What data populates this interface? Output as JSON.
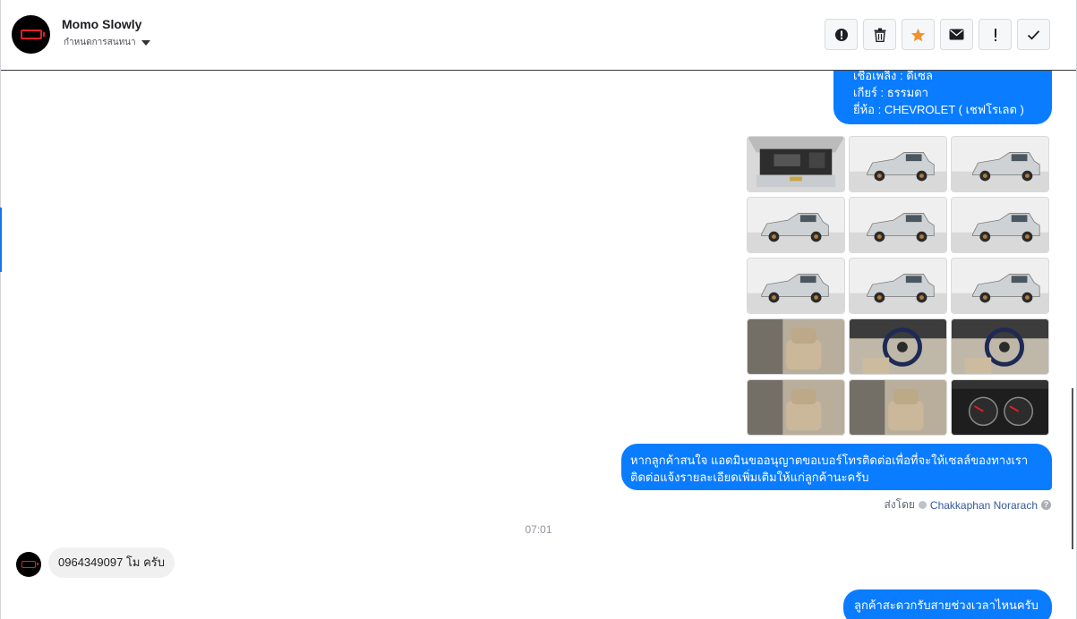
{
  "header": {
    "contact_name": "Momo Slowly",
    "assign_label": "กำหนดการสนทนา",
    "toolbar": [
      {
        "name": "spam-button",
        "icon": "alert-circle-icon"
      },
      {
        "name": "delete-button",
        "icon": "trash-icon"
      },
      {
        "name": "star-button",
        "icon": "star-icon",
        "color": "#f0922b"
      },
      {
        "name": "mark-unread-button",
        "icon": "envelope-icon"
      },
      {
        "name": "follow-up-button",
        "icon": "exclamation-icon"
      },
      {
        "name": "mark-done-button",
        "icon": "check-icon"
      }
    ]
  },
  "conversation": {
    "top_bubble": {
      "lines": [
        "เชื้อเพลิง : ดีเซล",
        "เกียร์ : ธรรมดา",
        "ยี่ห้อ : CHEVROLET ( เชฟโรเลต )"
      ]
    },
    "gallery": {
      "photos": [
        {
          "subject": "engine-bay"
        },
        {
          "subject": "truck-front-left"
        },
        {
          "subject": "truck-front"
        },
        {
          "subject": "truck-side-front"
        },
        {
          "subject": "truck-rear-right"
        },
        {
          "subject": "truck-rear"
        },
        {
          "subject": "truck-rear-left"
        },
        {
          "subject": "truck-side-wide"
        },
        {
          "subject": "truck-wheel-closeup"
        },
        {
          "subject": "door-panel"
        },
        {
          "subject": "steering-wheel"
        },
        {
          "subject": "dashboard-steering"
        },
        {
          "subject": "front-seats"
        },
        {
          "subject": "rear-cab"
        },
        {
          "subject": "instrument-cluster"
        }
      ]
    },
    "agent_message": {
      "line1": "หากลูกค้าสนใจ แอดมินขออนุญาตขอเบอร์โทรติดต่อเพื่อที่จะให้เซลล์ของทางเรา",
      "line2": "ติดต่อแจ้งรายละเอียดเพิ่มเติมให้แก่ลูกค้านะครับ"
    },
    "sent_by": {
      "prefix": "ส่งโดย",
      "agent": "Chakkaphan Norarach",
      "help": "?"
    },
    "timestamp": "07:01",
    "customer_message": "0964349097 โม ครับ",
    "bottom_bubble": "ลูกค้าสะดวกรับสายช่วงเวลาไหนครับ"
  },
  "colors": {
    "accent": "#0a7cff",
    "incoming_bubble": "#f1f0f0",
    "star": "#f0922b",
    "battery": "#e0202a"
  }
}
